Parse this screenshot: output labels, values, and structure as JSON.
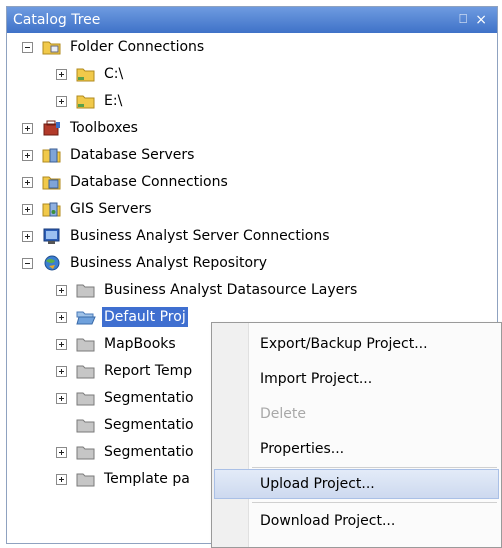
{
  "panel": {
    "title": "Catalog Tree",
    "pin_glyph": "⎕",
    "close_glyph": "×"
  },
  "tree": {
    "items": [
      {
        "label": "Folder Connections",
        "expander": "minus",
        "icon": "folder-connections-icon"
      },
      {
        "label": "C:\\",
        "expander": "plus",
        "icon": "folder-icon"
      },
      {
        "label": "E:\\",
        "expander": "plus",
        "icon": "folder-icon"
      },
      {
        "label": "Toolboxes",
        "expander": "plus",
        "icon": "toolbox-icon"
      },
      {
        "label": "Database Servers",
        "expander": "plus",
        "icon": "database-server-icon"
      },
      {
        "label": "Database Connections",
        "expander": "plus",
        "icon": "database-connection-icon"
      },
      {
        "label": "GIS Servers",
        "expander": "plus",
        "icon": "gis-server-icon"
      },
      {
        "label": "Business Analyst Server Connections",
        "expander": "plus",
        "icon": "server-connection-icon"
      },
      {
        "label": "Business Analyst Repository",
        "expander": "minus",
        "icon": "repository-icon"
      },
      {
        "label": "Business Analyst Datasource Layers",
        "expander": "plus",
        "icon": "grey-folder-icon"
      },
      {
        "label": "Default Proj",
        "expander": "plus",
        "icon": "open-folder-icon",
        "selected": true
      },
      {
        "label": "MapBooks",
        "expander": "plus",
        "icon": "grey-folder-icon"
      },
      {
        "label": "Report Temp",
        "expander": "plus",
        "icon": "grey-folder-icon"
      },
      {
        "label": "Segmentatio",
        "expander": "plus",
        "icon": "grey-folder-icon"
      },
      {
        "label": "Segmentatio",
        "expander": "none",
        "icon": "grey-folder-icon"
      },
      {
        "label": "Segmentatio",
        "expander": "plus",
        "icon": "grey-folder-icon"
      },
      {
        "label": "Template pa",
        "expander": "plus",
        "icon": "grey-folder-icon"
      }
    ]
  },
  "context_menu": {
    "items": [
      {
        "label": "Export/Backup Project...",
        "state": "normal"
      },
      {
        "label": "Import Project...",
        "state": "normal"
      },
      {
        "label": "Delete",
        "state": "disabled"
      },
      {
        "label": "Properties...",
        "state": "normal"
      },
      {
        "label": "Upload Project...",
        "state": "hover"
      },
      {
        "label": "Download Project...",
        "state": "normal"
      }
    ]
  },
  "colors": {
    "titlebar": "#4a7bd0",
    "selection": "#3f6fd0",
    "folder_yellow": "#f1c94a",
    "folder_grey": "#b8b8b8",
    "menu_hover": "#d6e1f3"
  }
}
